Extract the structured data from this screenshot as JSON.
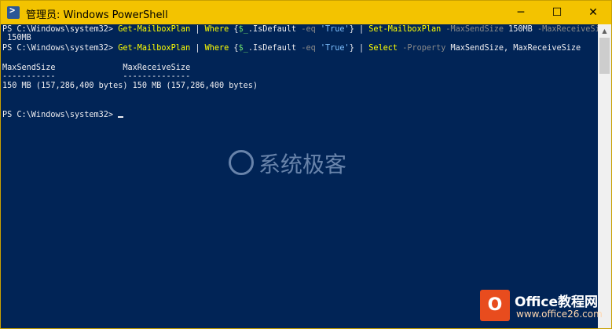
{
  "window": {
    "title": "管理员: Windows PowerShell",
    "controls": {
      "minimize": "─",
      "maximize": "☐",
      "close": "✕"
    },
    "icon": "powershell-icon"
  },
  "console": {
    "line1": {
      "prompt": "PS C:\\Windows\\system32> ",
      "c1": "Get-MailboxPlan",
      "s1": " | ",
      "c2": "Where",
      "s2": " {",
      "v1": "$_",
      "s3": ".IsDefault ",
      "p1": "-eq",
      "s4": " ",
      "str1": "'True'",
      "s5": "} | ",
      "c3": "Set-MailboxPlan",
      "s6": " ",
      "p2": "-MaxSendSize",
      "s7": " 150MB ",
      "p3": "-MaxReceiveSize"
    },
    "line1_wrap": " 150MB",
    "line2": {
      "prompt": "PS C:\\Windows\\system32> ",
      "c1": "Get-MailboxPlan",
      "s1": " | ",
      "c2": "Where",
      "s2": " {",
      "v1": "$_",
      "s3": ".IsDefault ",
      "p1": "-eq",
      "s4": " ",
      "str1": "'True'",
      "s5": "} | ",
      "c3": "Select",
      "s6": " ",
      "p2": "-Property",
      "s7": " MaxSendSize, MaxReceiveSize"
    },
    "table": {
      "header": "MaxSendSize              MaxReceiveSize",
      "underline": "-----------              --------------",
      "row": "150 MB (157,286,400 bytes) 150 MB (157,286,400 bytes)"
    },
    "prompt_final": "PS C:\\Windows\\system32> "
  },
  "watermark": {
    "text": "系统极客"
  },
  "badge": {
    "name": "Office教程网",
    "url": "www.office26.com",
    "icon_glyph": "O"
  },
  "colors": {
    "console_bg": "#012456",
    "titlebar": "#f3c300",
    "command": "#ffff00",
    "parameter": "#8a8a8a",
    "string": "#7ec0ff",
    "variable": "#6bde6b"
  }
}
